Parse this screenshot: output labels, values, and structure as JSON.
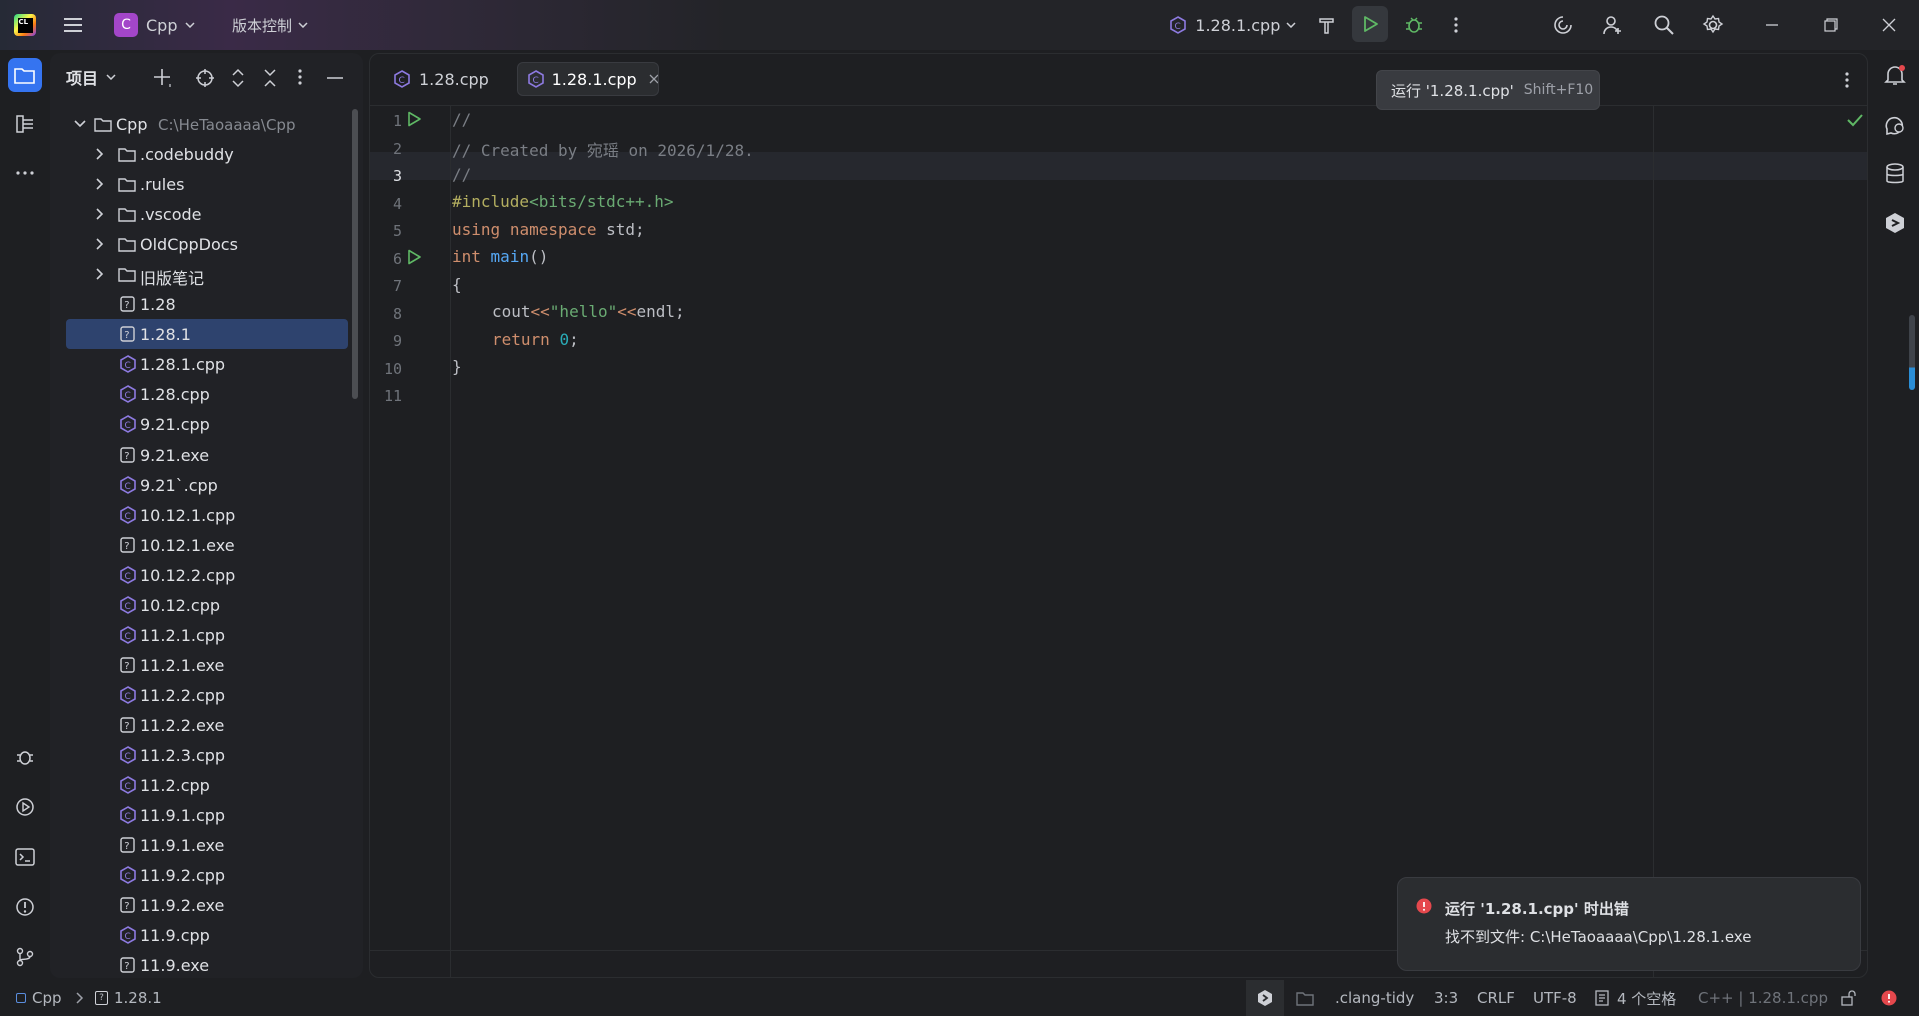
{
  "titlebar": {
    "project_letter": "C",
    "project_name": "Cpp",
    "vcs_label": "版本控制",
    "run_config": "1.28.1.cpp",
    "app_logo_text": "CL"
  },
  "project_panel": {
    "title": "项目",
    "root": {
      "name": "Cpp",
      "path": "C:\\HeTaoaaaa\\Cpp"
    },
    "items": [
      {
        "label": ".codebuddy",
        "type": "folder"
      },
      {
        "label": ".rules",
        "type": "folder"
      },
      {
        "label": ".vscode",
        "type": "folder"
      },
      {
        "label": "OldCppDocs",
        "type": "folder"
      },
      {
        "label": "旧版笔记",
        "type": "folder"
      },
      {
        "label": "1.28",
        "type": "unknown"
      },
      {
        "label": "1.28.1",
        "type": "unknown",
        "selected": true
      },
      {
        "label": "1.28.1.cpp",
        "type": "cpp"
      },
      {
        "label": "1.28.cpp",
        "type": "cpp"
      },
      {
        "label": "9.21.cpp",
        "type": "cpp"
      },
      {
        "label": "9.21.exe",
        "type": "unknown"
      },
      {
        "label": "9.21`.cpp",
        "type": "cpp"
      },
      {
        "label": "10.12.1.cpp",
        "type": "cpp"
      },
      {
        "label": "10.12.1.exe",
        "type": "unknown"
      },
      {
        "label": "10.12.2.cpp",
        "type": "cpp"
      },
      {
        "label": "10.12.cpp",
        "type": "cpp"
      },
      {
        "label": "11.2.1.cpp",
        "type": "cpp"
      },
      {
        "label": "11.2.1.exe",
        "type": "unknown"
      },
      {
        "label": "11.2.2.cpp",
        "type": "cpp"
      },
      {
        "label": "11.2.2.exe",
        "type": "unknown"
      },
      {
        "label": "11.2.3.cpp",
        "type": "cpp"
      },
      {
        "label": "11.2.cpp",
        "type": "cpp"
      },
      {
        "label": "11.9.1.cpp",
        "type": "cpp"
      },
      {
        "label": "11.9.1.exe",
        "type": "unknown"
      },
      {
        "label": "11.9.2.cpp",
        "type": "cpp"
      },
      {
        "label": "11.9.2.exe",
        "type": "unknown"
      },
      {
        "label": "11.9.cpp",
        "type": "cpp"
      },
      {
        "label": "11.9.exe",
        "type": "unknown"
      }
    ]
  },
  "editor": {
    "tabs": [
      {
        "label": "1.28.cpp",
        "active": false
      },
      {
        "label": "1.28.1.cpp",
        "active": true
      }
    ],
    "line_numbers": [
      "1",
      "2",
      "3",
      "4",
      "5",
      "6",
      "7",
      "8",
      "9",
      "10",
      "11"
    ],
    "current_line": "3",
    "code": {
      "l1": "//",
      "l2": "// Created by 宛瑶 on 2026/1/28.",
      "l3": "//",
      "l4_directive": "#include",
      "l4_header": "<bits/stdc++.h>",
      "l5_kw1": "using",
      "l5_kw2": "namespace",
      "l5_rest": " std;",
      "l6_type": "int",
      "l6_fn": "main",
      "l6_rest": "()",
      "l7": "{",
      "l8_a": "cout",
      "l8_op1": "<<",
      "l8_str": "\"hello\"",
      "l8_op2": "<<",
      "l8_b": "endl;",
      "l9_kw": "return",
      "l9_num": "0",
      "l9_rest": ";",
      "l10": "}"
    }
  },
  "tooltip": {
    "text": "运行 '1.28.1.cpp'",
    "shortcut": "Shift+F10"
  },
  "notification": {
    "title": "运行 '1.28.1.cpp' 时出错",
    "message": "找不到文件: C:\\HeTaoaaaa\\Cpp\\1.28.1.exe"
  },
  "statusbar": {
    "crumb_project": "Cpp",
    "crumb_file": "1.28.1",
    "clang_tidy": ".clang-tidy",
    "position": "3:3",
    "line_sep": "CRLF",
    "encoding": "UTF-8",
    "indent": "4 个空格",
    "language": "C++ | 1.28.1.cpp"
  },
  "colors": {
    "accent": "#3574f0",
    "run_green": "#5fb865",
    "error_red": "#e5484d",
    "selection": "#2e436e",
    "project_badge": "#a346c9"
  }
}
